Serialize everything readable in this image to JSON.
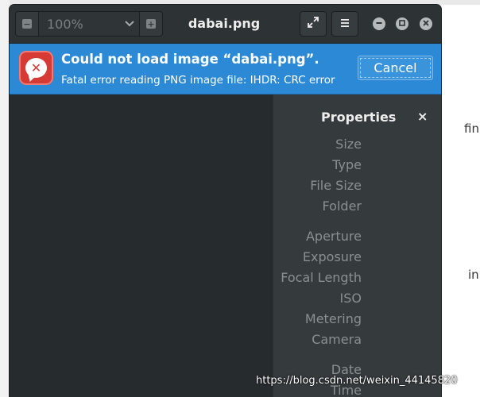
{
  "window": {
    "title": "dabai.png",
    "zoom": {
      "value": "100%"
    }
  },
  "infobar": {
    "title": "Could not load image “dabai.png”.",
    "message": "Fatal error reading PNG image file: IHDR: CRC error",
    "cancel_label": "Cancel"
  },
  "properties": {
    "title": "Properties",
    "close_glyph": "×",
    "labels": [
      "Size",
      "Type",
      "File Size",
      "Folder",
      "Aperture",
      "Exposure",
      "Focal Length",
      "ISO",
      "Metering",
      "Camera",
      "Date",
      "Time"
    ]
  },
  "background": {
    "fragment_1": "fin",
    "fragment_2": "in"
  },
  "watermark": "https://blog.csdn.net/weixin_44145820",
  "colors": {
    "infobar": "#2b89d6",
    "error_icon": "#d63a34",
    "headerbar": "#2d3234",
    "sidebar": "#353a3c",
    "canvas": "#262b2d"
  },
  "icons": {
    "zoom_out": "minus-icon",
    "zoom_in": "plus-icon",
    "dropdown": "chevron-down-icon",
    "fullscreen": "fullscreen-icon",
    "menu": "hamburger-menu-icon",
    "minimize": "minimize-icon",
    "maximize": "maximize-icon",
    "close": "close-icon",
    "error": "error-icon"
  }
}
